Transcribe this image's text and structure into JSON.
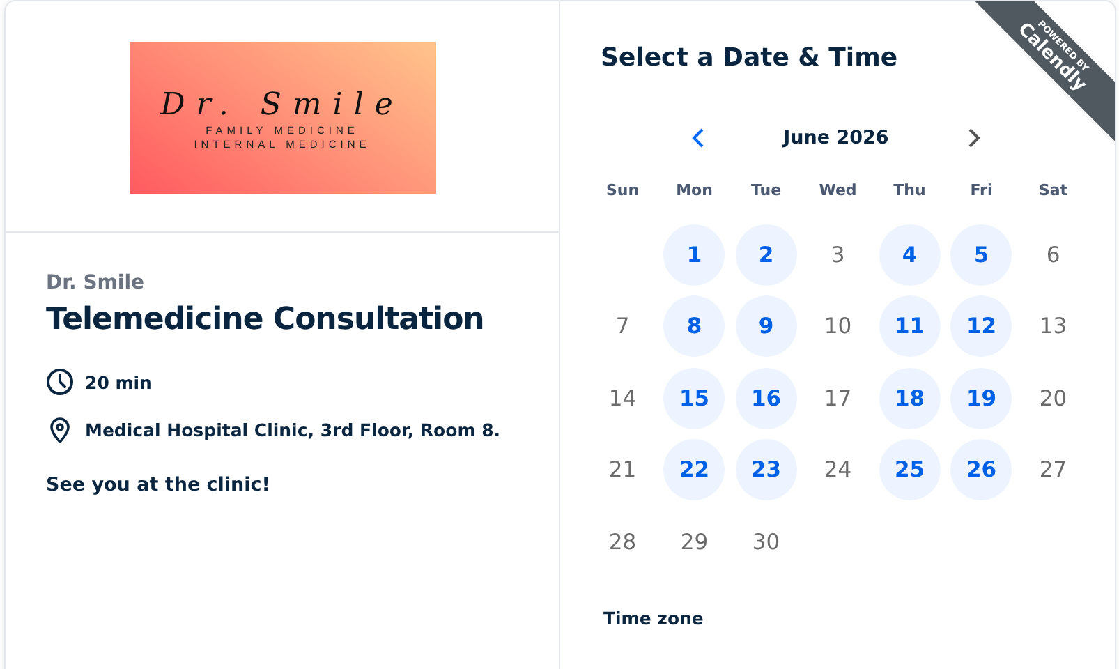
{
  "ribbon": {
    "top": "POWERED BY",
    "brand": "Calendly"
  },
  "logo": {
    "signature": "Dr. Smile",
    "lines": [
      "FAMILY MEDICINE",
      "INTERNAL MEDICINE"
    ]
  },
  "event": {
    "host": "Dr. Smile",
    "title": "Telemedicine Consultation",
    "details": [
      {
        "kind": "duration",
        "text": "20 min"
      },
      {
        "kind": "location",
        "text": "Medical Hospital Clinic, 3rd Floor, Room 8."
      }
    ],
    "description": "See you at the clinic!"
  },
  "calendar": {
    "title": "Select a Date & Time",
    "month": "June 2026",
    "prev_enabled": true,
    "next_enabled": false,
    "weekdays": [
      "Sun",
      "Mon",
      "Tue",
      "Wed",
      "Thu",
      "Fri",
      "Sat"
    ],
    "weeks": [
      [
        {
          "label": "1",
          "available": true
        },
        {
          "label": "2",
          "available": true
        },
        {
          "label": "3",
          "available": false
        },
        {
          "label": "4",
          "available": true
        },
        {
          "label": "5",
          "available": true
        },
        {
          "label": "6",
          "available": false
        }
      ],
      [
        {
          "label": "7",
          "available": false
        },
        {
          "label": "8",
          "available": true
        },
        {
          "label": "9",
          "available": true
        },
        {
          "label": "10",
          "available": false
        },
        {
          "label": "11",
          "available": true
        },
        {
          "label": "12",
          "available": true
        },
        {
          "label": "13",
          "available": false
        }
      ],
      [
        {
          "label": "14",
          "available": false
        },
        {
          "label": "15",
          "available": true
        },
        {
          "label": "16",
          "available": true
        },
        {
          "label": "17",
          "available": false
        },
        {
          "label": "18",
          "available": true
        },
        {
          "label": "19",
          "available": true
        },
        {
          "label": "20",
          "available": false
        }
      ],
      [
        {
          "label": "21",
          "available": false
        },
        {
          "label": "22",
          "available": true
        },
        {
          "label": "23",
          "available": true
        },
        {
          "label": "24",
          "available": false
        },
        {
          "label": "25",
          "available": true
        },
        {
          "label": "26",
          "available": true
        },
        {
          "label": "27",
          "available": false
        }
      ],
      [
        {
          "label": "28",
          "available": false
        },
        {
          "label": "29",
          "available": false
        },
        {
          "label": "30",
          "available": false
        }
      ]
    ],
    "timezone_label": "Time zone"
  }
}
